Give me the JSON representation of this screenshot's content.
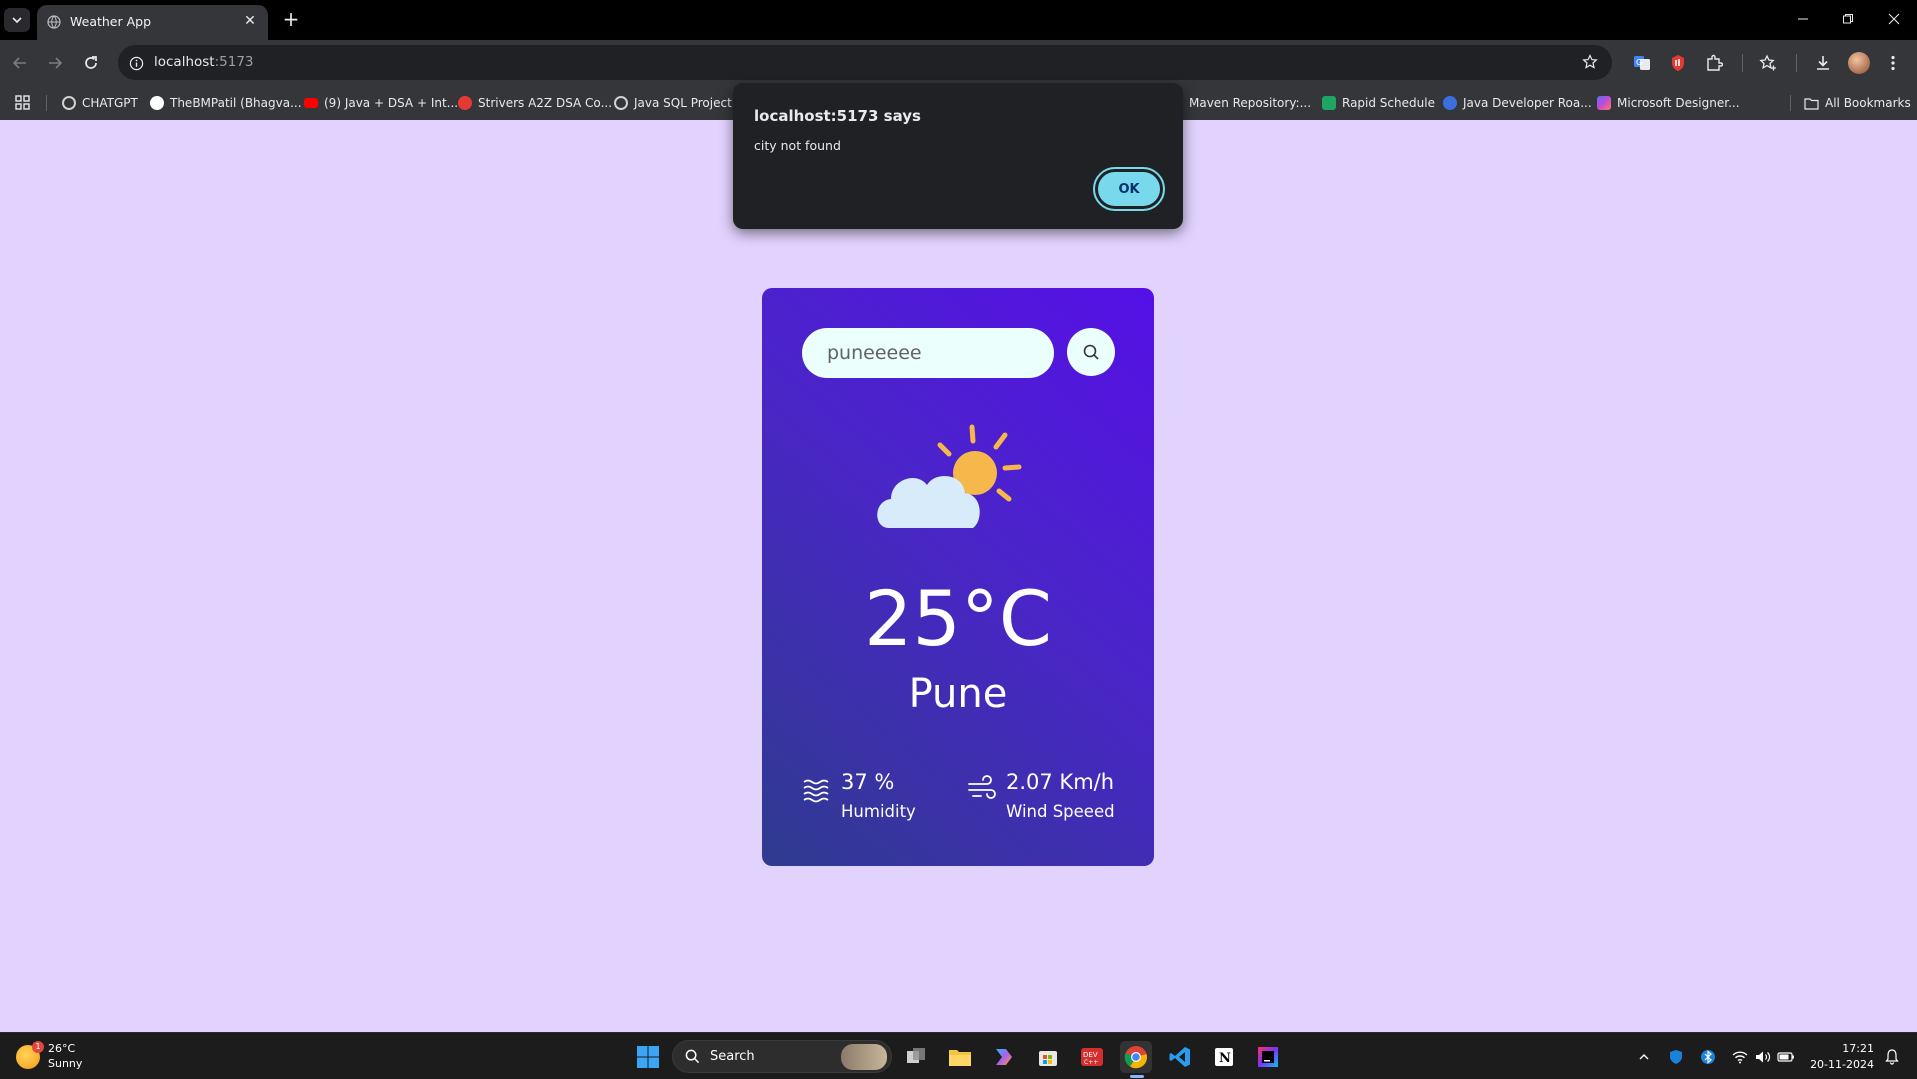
{
  "browser": {
    "tab_title": "Weather App",
    "url_host": "localhost",
    "url_port": ":5173",
    "bookmarks": [
      {
        "label": "CHATGPT",
        "color": "#d0d0d0"
      },
      {
        "label": "TheBMPatil (Bhagva...",
        "color": "#ffffff"
      },
      {
        "label": "(9) Java + DSA + Int...",
        "color": "#ff0000"
      },
      {
        "label": "Strivers A2Z DSA Co...",
        "color": "#e53935"
      },
      {
        "label": "Java SQL Project H",
        "color": "#d0d0d0"
      },
      {
        "label": "Maven Repository:...",
        "color": "#35363a"
      },
      {
        "label": "Rapid Schedule",
        "color": "#1fa463"
      },
      {
        "label": "Java Developer Roa...",
        "color": "#3b6fe0"
      },
      {
        "label": "Microsoft Designer...",
        "color": "#c04cd8"
      }
    ],
    "all_bookmarks": "All Bookmarks"
  },
  "alert": {
    "title": "localhost:5173 says",
    "message": "city not found",
    "ok_label": "OK"
  },
  "weather": {
    "search_value": "puneeeee",
    "icon": "sun-behind-cloud",
    "temperature": "25°C",
    "city": "Pune",
    "humidity_value": "37 %",
    "humidity_label": "Humidity",
    "wind_value": "2.07 Km/h",
    "wind_label": "Wind Speeed"
  },
  "taskbar": {
    "weather_temp": "26°C",
    "weather_desc": "Sunny",
    "weather_badge": "1",
    "search_label": "Search",
    "time": "17:21",
    "date": "20-11-2024"
  },
  "colors": {
    "page_bg": "#e2d3fe",
    "card_gradient_start": "#2f3b8f",
    "card_gradient_end": "#5510e6",
    "input_bg": "#ebfffc",
    "ok_button": "#78d9ec"
  }
}
